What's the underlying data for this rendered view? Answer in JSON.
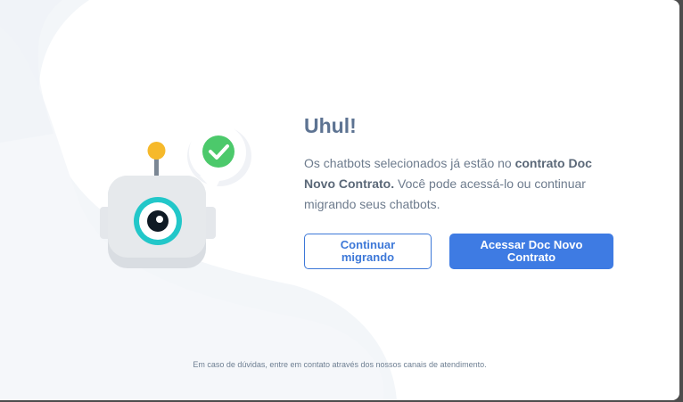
{
  "dialog": {
    "title": "Uhul!",
    "message_prefix": "Os chatbots selecionados já estão no ",
    "message_bold": "contrato Doc Novo Contrato.",
    "message_suffix": " Você pode acessá-lo ou continuar migrando seus chatbots.",
    "continue_button": "Continuar migrando",
    "access_button": "Acessar Doc Novo Contrato",
    "footer": "Em caso de dúvidas, entre em contato através dos nossos canais de atendimento."
  },
  "illustration": {
    "robot_icon": "robot-icon",
    "check_icon": "check-circle-icon"
  },
  "colors": {
    "accent": "#3e7be3",
    "title": "#5d7392",
    "check": "#4cc96b",
    "antenna": "#f6b92b",
    "eye_ring": "#22c7c9"
  }
}
